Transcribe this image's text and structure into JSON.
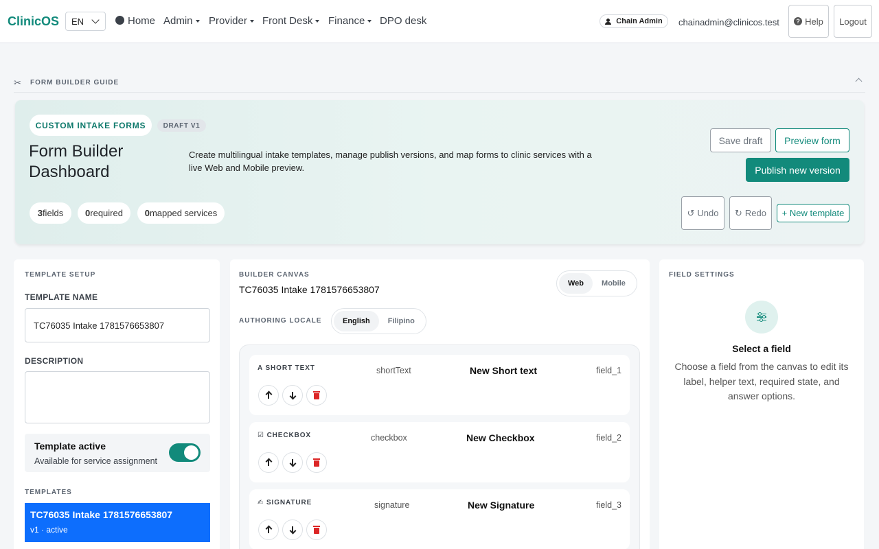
{
  "nav": {
    "brand": "ClinicOS",
    "language": "EN",
    "items": [
      {
        "label": "Home",
        "icon": "globe-icon"
      },
      {
        "label": "Admin"
      },
      {
        "label": "Provider"
      },
      {
        "label": "Front Desk"
      },
      {
        "label": "Finance"
      },
      {
        "label": "DPO desk"
      }
    ],
    "role_badge": "Chain Admin",
    "email": "chainadmin@clinicos.test",
    "help_label": "Help",
    "logout_label": "Logout"
  },
  "guide": {
    "label": "FORM BUILDER GUIDE"
  },
  "hero": {
    "tag": "CUSTOM INTAKE FORMS",
    "version": "DRAFT V1",
    "title": "Form Builder Dashboard",
    "description": "Create multilingual intake templates, manage publish versions, and map forms to clinic services with a live Web and Mobile preview.",
    "counts": [
      {
        "value": "3",
        "label": "fields"
      },
      {
        "value": "0",
        "label": "required"
      },
      {
        "value": "0",
        "label": "mapped services"
      }
    ],
    "save_draft": "Save draft",
    "preview_form": "Preview form",
    "publish": "Publish new version",
    "undo": "Undo",
    "redo": "Redo",
    "new_template": "+ New template"
  },
  "setup": {
    "caption": "TEMPLATE SETUP",
    "name_label": "TEMPLATE NAME",
    "name_value": "TC76035 Intake 1781576653807",
    "description_label": "DESCRIPTION",
    "description_value": "",
    "active_title": "Template active",
    "active_sub": "Available for service assignment",
    "active_on": true,
    "templates_caption": "TEMPLATES",
    "templates": [
      {
        "name": "TC76035 Intake 1781576653807",
        "meta": "v1 · active"
      }
    ]
  },
  "canvas": {
    "caption": "BUILDER CANVAS",
    "template_name": "TC76035 Intake 1781576653807",
    "views": [
      "Web",
      "Mobile"
    ],
    "active_view": "Web",
    "locale_caption": "AUTHORING LOCALE",
    "locales": [
      "English",
      "Filipino"
    ],
    "active_locale": "English",
    "fields": [
      {
        "type": "SHORT TEXT",
        "icon": "text-icon",
        "key": "shortText",
        "label": "New Short text",
        "id": "field_1"
      },
      {
        "type": "CHECKBOX",
        "icon": "checkbox-icon",
        "key": "checkbox",
        "label": "New Checkbox",
        "id": "field_2"
      },
      {
        "type": "SIGNATURE",
        "icon": "signature-icon",
        "key": "signature",
        "label": "New Signature",
        "id": "field_3"
      }
    ]
  },
  "settings": {
    "caption": "FIELD SETTINGS",
    "empty_title": "Select a field",
    "empty_text": "Choose a field from the canvas to edit its label, helper text, required state, and answer options."
  },
  "colors": {
    "brand": "#128a7b",
    "selected_template": "#0d6efd",
    "delete": "#dc2626"
  }
}
